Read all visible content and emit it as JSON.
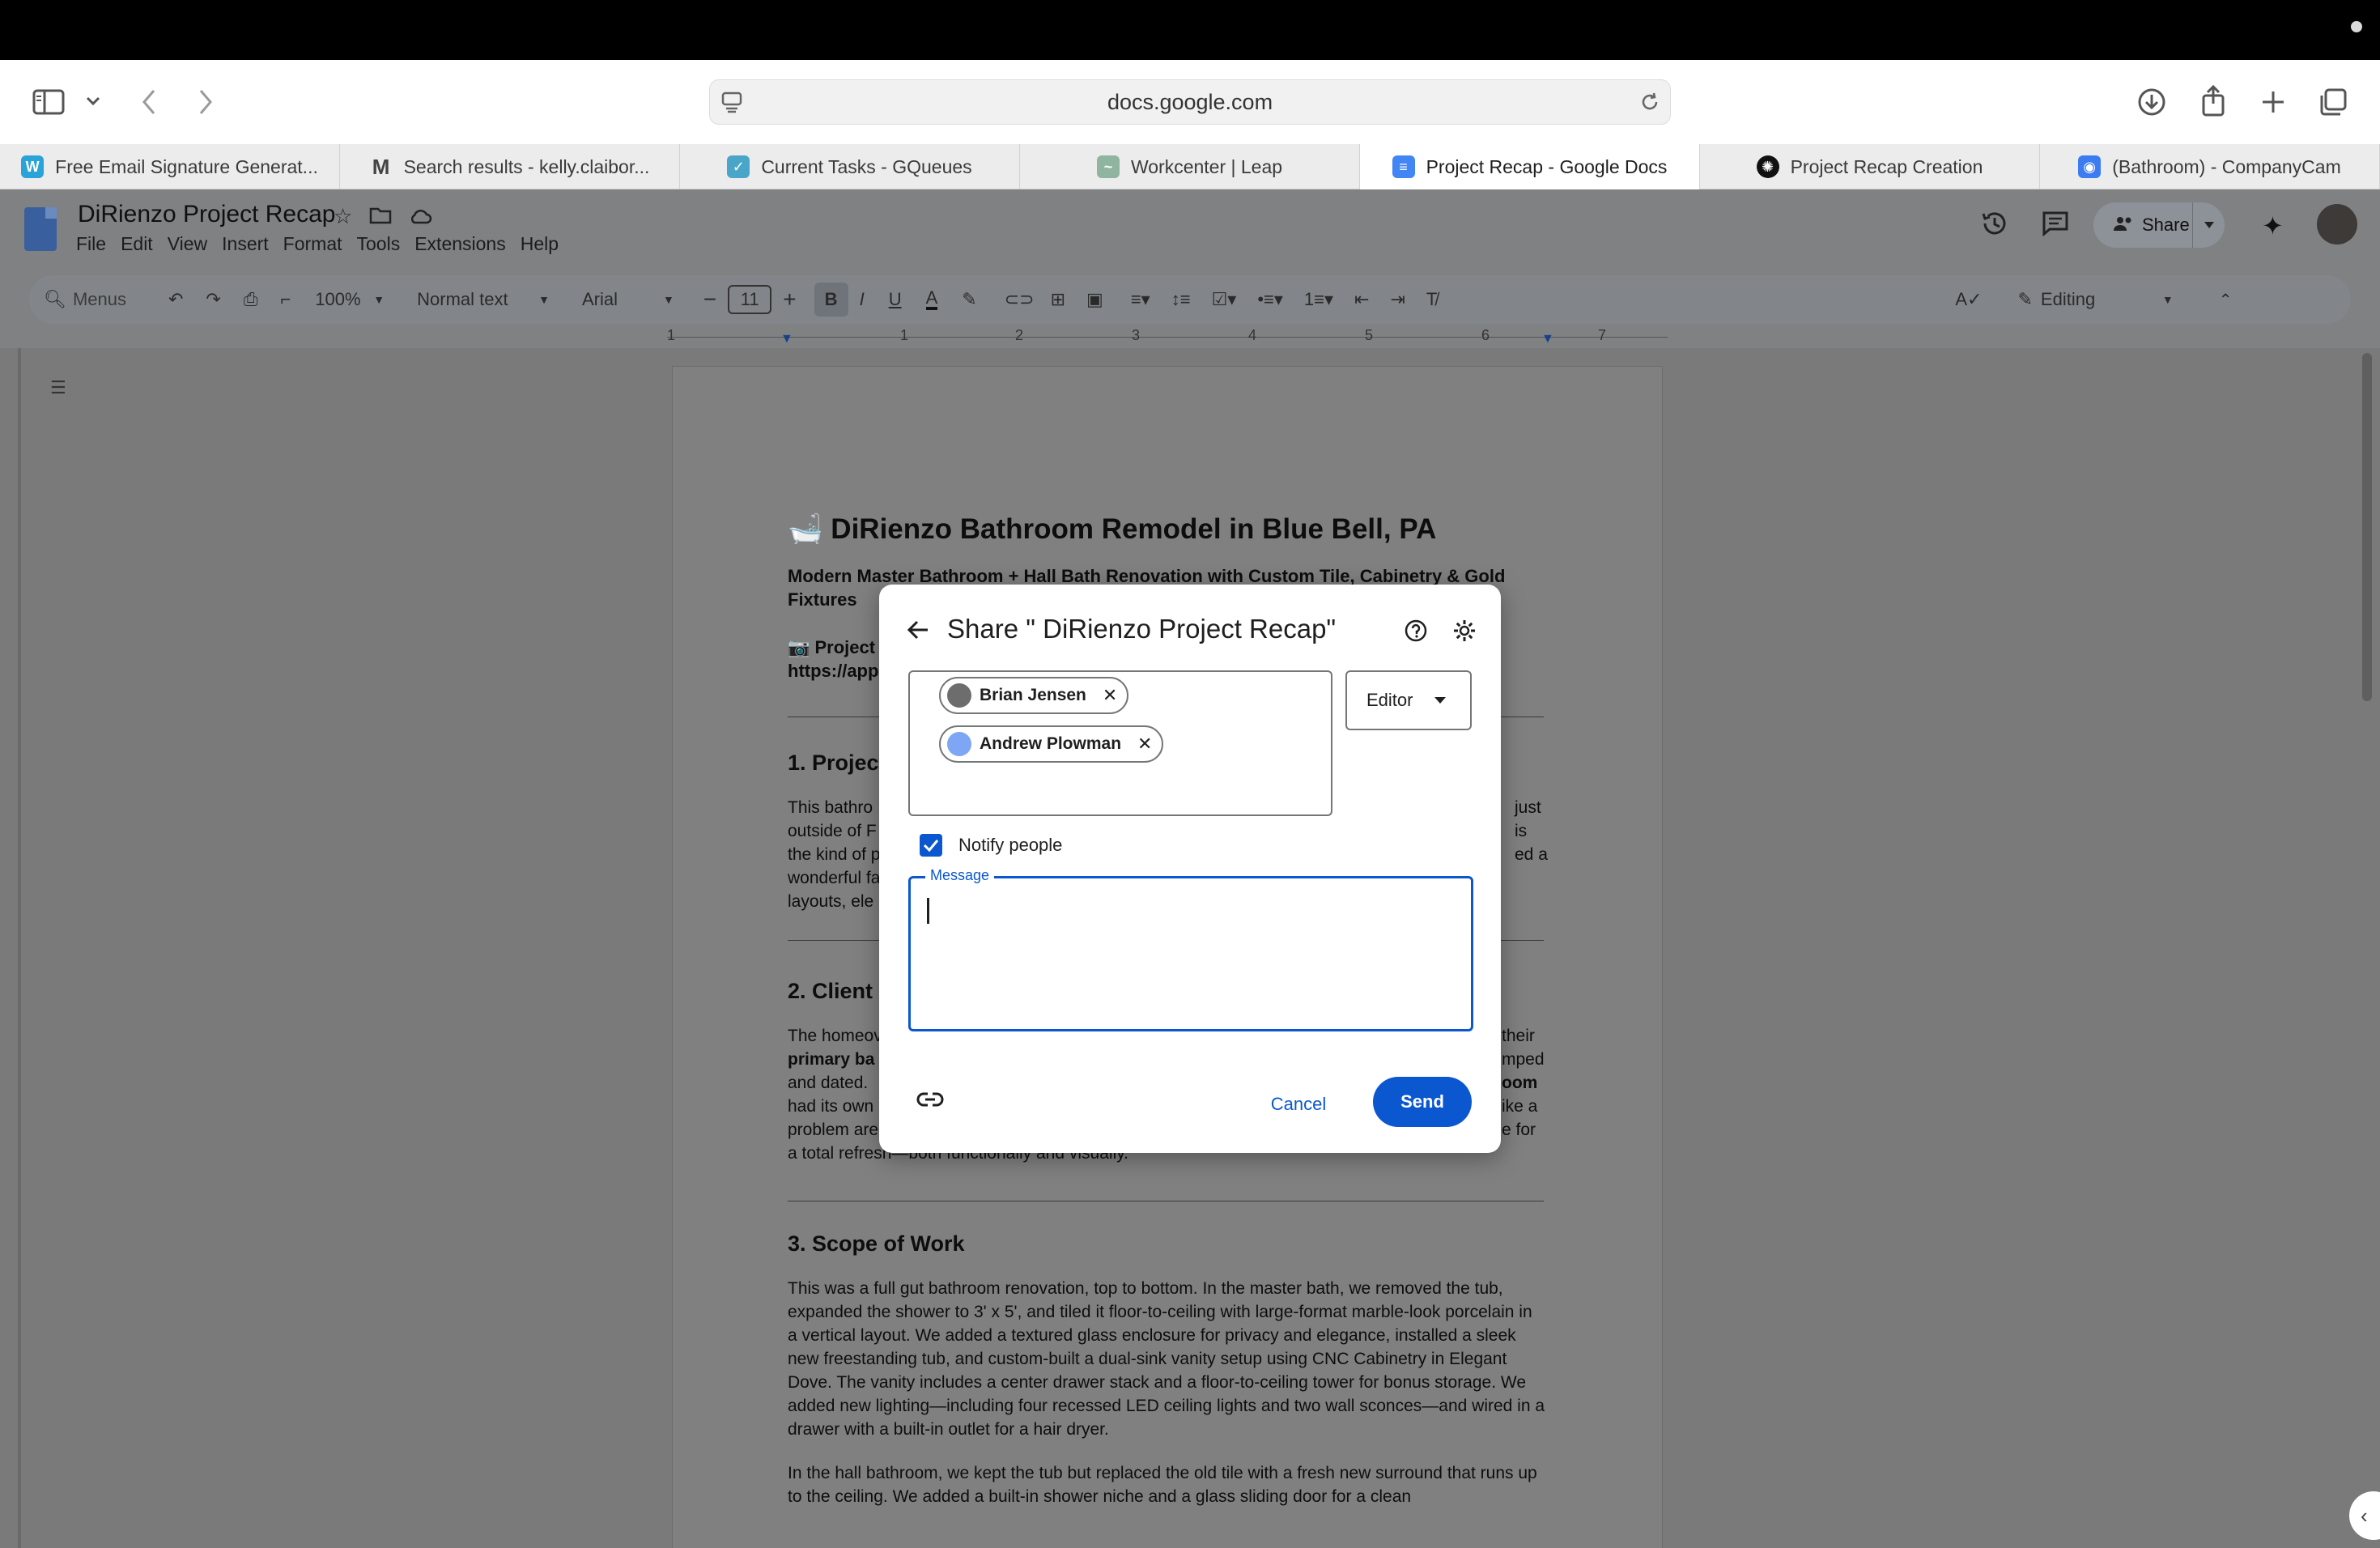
{
  "browser": {
    "url": "docs.google.com",
    "tabs": [
      {
        "title": "Free Email Signature Generat...",
        "icon": "wisestamp-icon",
        "color": "#2aa3d8"
      },
      {
        "title": "Search results - kelly.claibor...",
        "icon": "gmail-icon",
        "color": "#444444"
      },
      {
        "title": "Current Tasks - GQueues",
        "icon": "gqueues-icon",
        "color": "#4aa6c9"
      },
      {
        "title": "Workcenter | Leap",
        "icon": "leap-icon",
        "color": "#8fb4a0"
      },
      {
        "title": "Project Recap - Google Docs",
        "icon": "google-docs-icon",
        "color": "#4285f4"
      },
      {
        "title": "Project Recap Creation",
        "icon": "openai-icon",
        "color": "#111111"
      },
      {
        "title": "(Bathroom) - CompanyCam",
        "icon": "companycam-icon",
        "color": "#3d7bf0"
      }
    ]
  },
  "docs": {
    "title": "DiRienzo Project Recap",
    "menu": [
      "File",
      "Edit",
      "View",
      "Insert",
      "Format",
      "Tools",
      "Extensions",
      "Help"
    ],
    "share_label": "Share",
    "toolbar": {
      "menus": "Menus",
      "zoom": "100%",
      "style": "Normal text",
      "font": "Arial",
      "font_size": "11",
      "mode": "Editing"
    },
    "ruler_marks": [
      "1",
      "1",
      "2",
      "3",
      "4",
      "5",
      "6",
      "7"
    ]
  },
  "document": {
    "heading": "🛁 DiRienzo Bathroom Remodel in Blue Bell, PA",
    "subheading": "Modern Master Bathroom + Hall Bath Renovation with Custom Tile, Cabinetry & Gold Fixtures",
    "project_link_label": "📷 Project",
    "project_link_url": "https://app.",
    "section1_title": "1. Project",
    "section1_lines": [
      "This bathro",
      "outside of F",
      "the kind of p",
      "wonderful fa",
      "layouts, ele"
    ],
    "section1_right": [
      "just",
      "is",
      "ed a",
      "",
      ""
    ],
    "section2_title": "2. Client C",
    "section2_lines": [
      "The homeov",
      "primary ba",
      "and dated. ",
      "had its own",
      "problem are",
      "a total refresh—both functionally and visually."
    ],
    "section2_right": [
      "their",
      "mped",
      "oom",
      "ike a",
      "e for",
      ""
    ],
    "section3_title": "3. Scope of Work",
    "section3_p1": "This was a full gut bathroom renovation, top to bottom. In the master bath, we removed the tub, expanded the shower to 3' x 5', and tiled it floor-to-ceiling with large-format marble-look porcelain in a vertical layout. We added a textured glass enclosure for privacy and elegance, installed a sleek new freestanding tub, and custom-built a dual-sink vanity setup using CNC Cabinetry in Elegant Dove. The vanity includes a center drawer stack and a floor-to-ceiling tower for bonus storage. We added new lighting—including four recessed LED ceiling lights and two wall sconces—and wired in a drawer with a built-in outlet for a hair dryer.",
    "section3_p2": "In the hall bathroom, we kept the tub but replaced the old tile with a fresh new surround that runs up to the ceiling. We added a built-in shower niche and a glass sliding door for a clean"
  },
  "share_dialog": {
    "title": "Share \" DiRienzo Project Recap\"",
    "people": [
      {
        "name": "Brian Jensen",
        "avatar_color": "#6d6d6d"
      },
      {
        "name": "Andrew Plowman",
        "avatar_color": "#7ea6f4"
      }
    ],
    "role": "Editor",
    "notify_label": "Notify people",
    "notify_checked": true,
    "message_label": "Message",
    "message_value": "",
    "cancel_label": "Cancel",
    "send_label": "Send",
    "accent": "#0b57d0"
  }
}
